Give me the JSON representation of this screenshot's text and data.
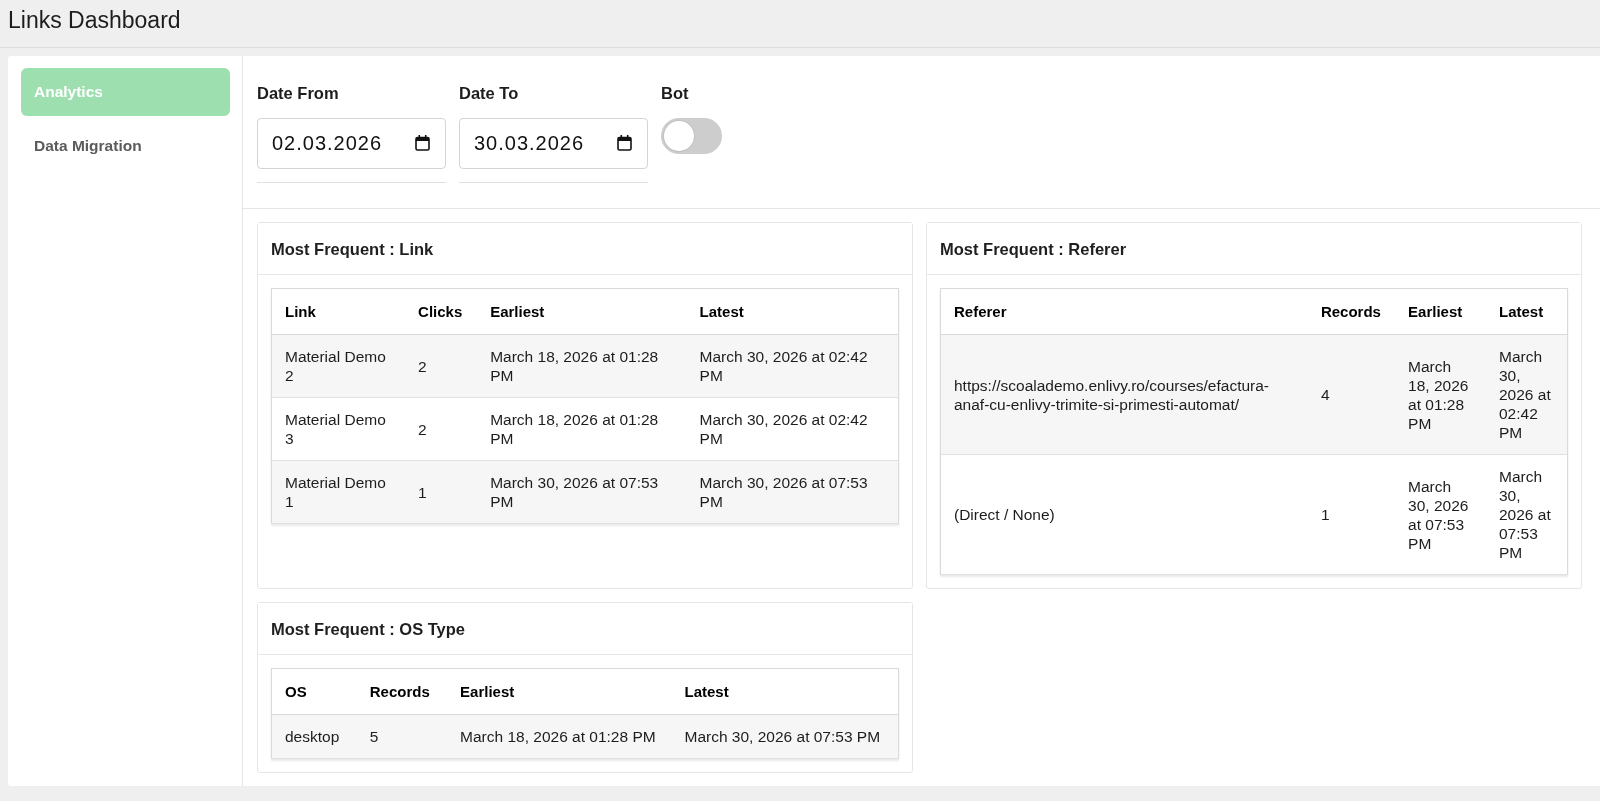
{
  "page_title": "Links Dashboard",
  "sidebar": {
    "items": [
      {
        "label": "Analytics",
        "selected": true
      },
      {
        "label": "Data Migration",
        "selected": false
      }
    ]
  },
  "filters": [
    {
      "kind": "date",
      "label": "Date From",
      "value": "02.03.2026"
    },
    {
      "kind": "date",
      "label": "Date To",
      "value": "30.03.2026"
    },
    {
      "kind": "toggle",
      "label": "Bot",
      "on": false
    }
  ],
  "cards": [
    {
      "title": "Most Frequent : Link",
      "table": {
        "columns": [
          "Link",
          "Clicks",
          "Earliest",
          "Latest"
        ],
        "rows": [
          [
            "Material Demo 2",
            "2",
            "March 18, 2026 at 01:28 PM",
            "March 30, 2026 at 02:42 PM"
          ],
          [
            "Material Demo 3",
            "2",
            "March 18, 2026 at 01:28 PM",
            "March 30, 2026 at 02:42 PM"
          ],
          [
            "Material Demo 1",
            "1",
            "March 30, 2026 at 07:53 PM",
            "March 30, 2026 at 07:53 PM"
          ]
        ]
      }
    },
    {
      "title": "Most Frequent : Referer",
      "table": {
        "columns": [
          "Referer",
          "Records",
          "Earliest",
          "Latest"
        ],
        "rows": [
          [
            "https://scoalademo.enlivy.ro/courses/efactura-anaf-cu-enlivy-trimite-si-primesti-automat/",
            "4",
            "March 18, 2026 at 01:28 PM",
            "March 30, 2026 at 02:42 PM"
          ],
          [
            "(Direct / None)",
            "1",
            "March 30, 2026 at 07:53 PM",
            "March 30, 2026 at 07:53 PM"
          ]
        ]
      }
    },
    {
      "title": "Most Frequent : OS Type",
      "table": {
        "columns": [
          "OS",
          "Records",
          "Earliest",
          "Latest"
        ],
        "rows": [
          [
            "desktop",
            "5",
            "March 18, 2026 at 01:28 PM",
            "March 30, 2026 at 07:53 PM"
          ]
        ]
      }
    }
  ]
}
